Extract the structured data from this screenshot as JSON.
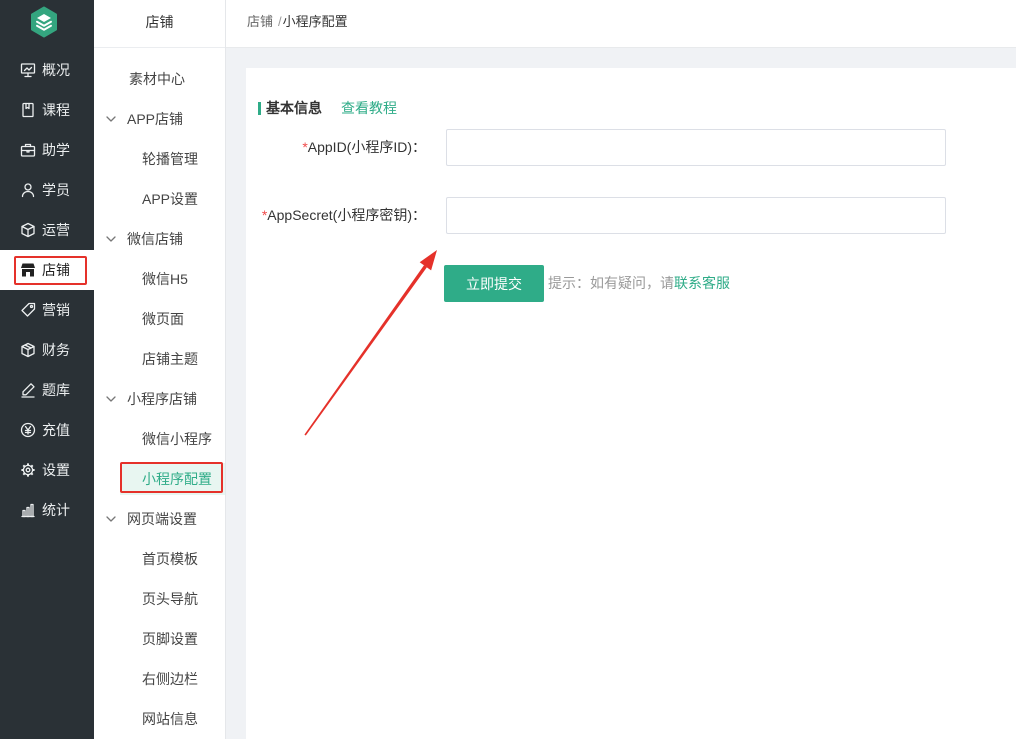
{
  "colors": {
    "accent": "#2fac88",
    "sidebar_bg": "#2a3136",
    "active_sub_bg": "#e8f6f1",
    "required": "#f04b4b",
    "annotation": "#e5312a"
  },
  "logo": {
    "icon": "layers-hexagon-icon"
  },
  "main_nav": {
    "items": [
      {
        "label": "概况",
        "icon": "presentation-icon"
      },
      {
        "label": "课程",
        "icon": "book-icon"
      },
      {
        "label": "助学",
        "icon": "briefcase-icon"
      },
      {
        "label": "学员",
        "icon": "user-icon"
      },
      {
        "label": "运营",
        "icon": "cube-icon"
      },
      {
        "label": "店铺",
        "icon": "store-icon",
        "active": true
      },
      {
        "label": "营销",
        "icon": "tag-icon"
      },
      {
        "label": "财务",
        "icon": "box-icon"
      },
      {
        "label": "题库",
        "icon": "pencil-icon"
      },
      {
        "label": "充值",
        "icon": "yen-circle-icon"
      },
      {
        "label": "设置",
        "icon": "gear-icon"
      },
      {
        "label": "统计",
        "icon": "bar-chart-icon"
      }
    ]
  },
  "sub_nav": {
    "title": "店铺",
    "top_item": {
      "label": "素材中心"
    },
    "groups": [
      {
        "label": "APP店铺",
        "expanded": true,
        "icon": "chevron-down-icon",
        "items": [
          {
            "label": "轮播管理"
          },
          {
            "label": "APP设置"
          }
        ]
      },
      {
        "label": "微信店铺",
        "expanded": true,
        "icon": "chevron-down-icon",
        "items": [
          {
            "label": "微信H5"
          },
          {
            "label": "微页面"
          },
          {
            "label": "店铺主题"
          }
        ]
      },
      {
        "label": "小程序店铺",
        "expanded": true,
        "icon": "chevron-down-icon",
        "items": [
          {
            "label": "微信小程序"
          },
          {
            "label": "小程序配置",
            "active": true
          }
        ]
      },
      {
        "label": "网页端设置",
        "expanded": true,
        "icon": "chevron-down-icon",
        "items": [
          {
            "label": "首页模板"
          },
          {
            "label": "页头导航"
          },
          {
            "label": "页脚设置"
          },
          {
            "label": "右侧边栏"
          },
          {
            "label": "网站信息"
          }
        ]
      }
    ]
  },
  "breadcrumb": {
    "root": "店铺",
    "separator": "/",
    "current": "小程序配置"
  },
  "form": {
    "section_title": "基本信息",
    "tutorial_link": "查看教程",
    "fields": [
      {
        "required_mark": "*",
        "label": "AppID(小程序ID)：",
        "value": ""
      },
      {
        "required_mark": "*",
        "label": "AppSecret(小程序密钥)：",
        "value": ""
      }
    ],
    "submit_label": "立即提交",
    "hint_text": "提示：如有疑问，请",
    "hint_link": "联系客服"
  }
}
